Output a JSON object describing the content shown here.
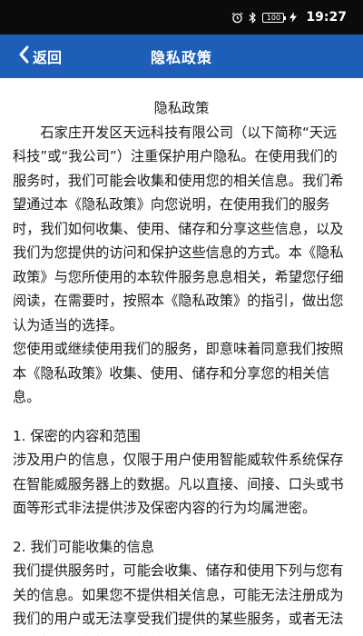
{
  "status_bar": {
    "battery": "100",
    "time": "19:27",
    "icons": [
      "alarm-icon",
      "bluetooth-icon",
      "battery-icon",
      "charging-icon"
    ]
  },
  "nav": {
    "back_label": "返回",
    "title": "隐私政策"
  },
  "content": {
    "title": "隐私政策",
    "intro": "石家庄开发区天远科技有限公司（以下简称“天远科技”或“我公司”）注重保护用户隐私。在使用我们的服务时，我们可能会收集和使用您的相关信息。我们希望通过本《隐私政策》向您说明，在使用我们的服务时，我们如何收集、使用、储存和分享这些信息，以及我们为您提供的访问和保护这些信息的方式。本《隐私政策》与您所使用的本软件服务息息相关，希望您仔细阅读，在需要时，按照本《隐私政策》的指引，做出您认为适当的选择。",
    "intro2": "您使用或继续使用我们的服务，即意味着同意我们按照本《隐私政策》收集、使用、储存和分享您的相关信息。",
    "sections": [
      {
        "heading": "1. 保密的内容和范围",
        "body": "涉及用户的信息，仅限于用户使用智能威软件系统保存在智能威服务器上的数据。凡以直接、间接、口头或书面等形式非法提供涉及保密内容的行为均属泄密。"
      },
      {
        "heading": "2. 我们可能收集的信息",
        "body": "我们提供服务时，可能会收集、储存和使用下列与您有关的信息。如果您不提供相关信息，可能无法注册成为我们的用户或无法享受我们提供的某些服务，或者无法达到相关服务拟达到的效果。"
      }
    ]
  },
  "colors": {
    "status_bar_bg": "#0b0b0b",
    "nav_bg": "#1d5fb8",
    "text": "#1a1a1a"
  }
}
